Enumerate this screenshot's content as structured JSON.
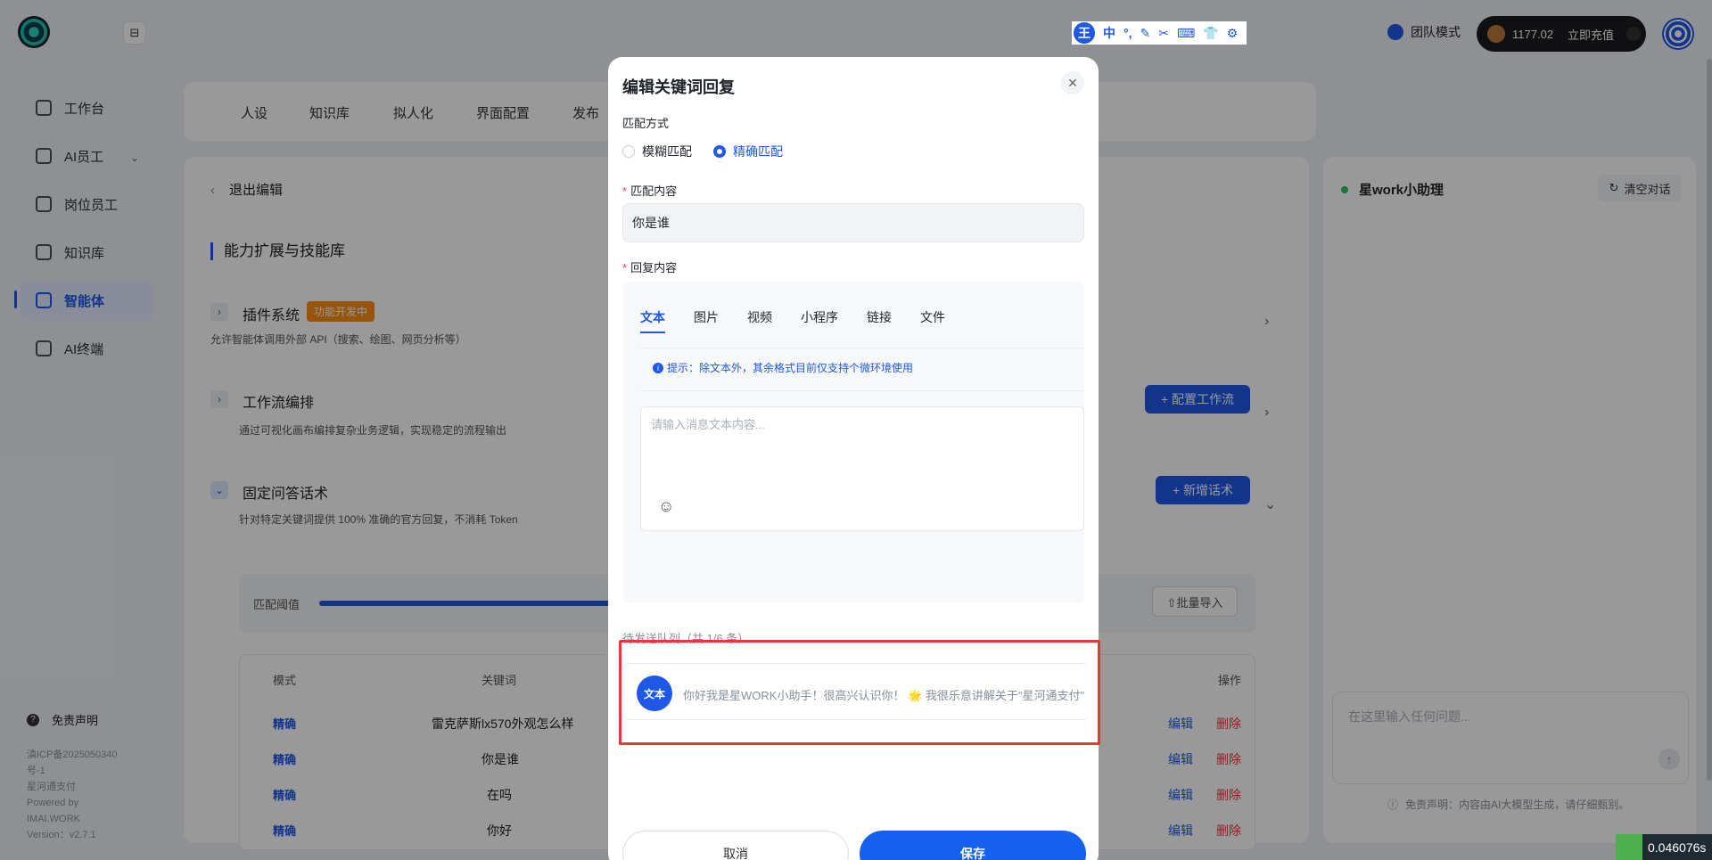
{
  "sidebar": {
    "items": [
      {
        "label": "工作台"
      },
      {
        "label": "AI员工"
      },
      {
        "label": "岗位员工"
      },
      {
        "label": "知识库"
      },
      {
        "label": "智能体"
      },
      {
        "label": "AI终端"
      }
    ],
    "disclaimer": "免责声明",
    "icp": "滇ICP备2025050340号-1",
    "company": "星河通支付",
    "powered": "Powered by",
    "brand": "IMAI.WORK",
    "version": "Version：v2.7.1"
  },
  "header": {
    "ime": {
      "main": "王",
      "icons": [
        "中",
        "°,",
        "✎",
        "✂",
        "⌨",
        "👕",
        "⚙"
      ]
    },
    "team_mode": "团队模式",
    "balance": "1177.02",
    "recharge": "立即充值"
  },
  "top_tabs": [
    "人设",
    "知识库",
    "拟人化",
    "界面配置",
    "发布"
  ],
  "main": {
    "back": "退出编辑",
    "section_title": "能力扩展与技能库",
    "plugin": {
      "title": "插件系统",
      "badge": "功能开发中",
      "desc": "允许智能体调用外部 API（搜索、绘图、网页分析等）"
    },
    "workflow": {
      "title": "工作流编排",
      "desc": "通过可视化画布编排复杂业务逻辑，实现稳定的流程输出",
      "button": "+ 配置工作流"
    },
    "qa": {
      "title": "固定问答话术",
      "desc": "针对特定关键词提供 100% 准确的官方回复，不消耗 Token",
      "button": "+ 新增话术"
    },
    "threshold_label": "匹配阈值",
    "batch_import": "⇧批量导入",
    "table": {
      "headers": [
        "模式",
        "关键词",
        "操作"
      ],
      "rows": [
        {
          "mode": "精确",
          "keyword": "雷克萨斯lx570外观怎么样",
          "edit": "编辑",
          "delete": "删除"
        },
        {
          "mode": "精确",
          "keyword": "你是谁",
          "edit": "编辑",
          "delete": "删除"
        },
        {
          "mode": "精确",
          "keyword": "在吗",
          "edit": "编辑",
          "delete": "删除"
        },
        {
          "mode": "精确",
          "keyword": "你好",
          "edit": "编辑",
          "delete": "删除"
        }
      ]
    }
  },
  "chat": {
    "title": "星work小助理",
    "clear": "清空对话",
    "placeholder": "在这里输入任何问题...",
    "disclaimer": "免责声明：内容由AI大模型生成，请仔细甄别。"
  },
  "modal": {
    "title": "编辑关键词回复",
    "match_label": "匹配方式",
    "fuzzy": "模糊匹配",
    "exact": "精确匹配",
    "content_label": "匹配内容",
    "content_value": "你是谁",
    "reply_label": "回复内容",
    "tabs": [
      "文本",
      "图片",
      "视频",
      "小程序",
      "链接",
      "文件"
    ],
    "tip": "提示：除文本外，其余格式目前仅支持个微环境使用",
    "textarea_placeholder": "请输入消息文本内容...",
    "queue_label": "待发送队列（共 1/6 条）",
    "queue_pill": "文本",
    "queue_text": "你好我是星WORK小助手！很高兴认识你！ 🌟 我很乐意讲解关于\"星河通支付\"",
    "cancel": "取消",
    "save": "保存"
  },
  "timer": "0.046076s",
  "colors": {
    "accent": "#1f58e6",
    "danger": "#e53935",
    "badge": "#fa8c16"
  }
}
